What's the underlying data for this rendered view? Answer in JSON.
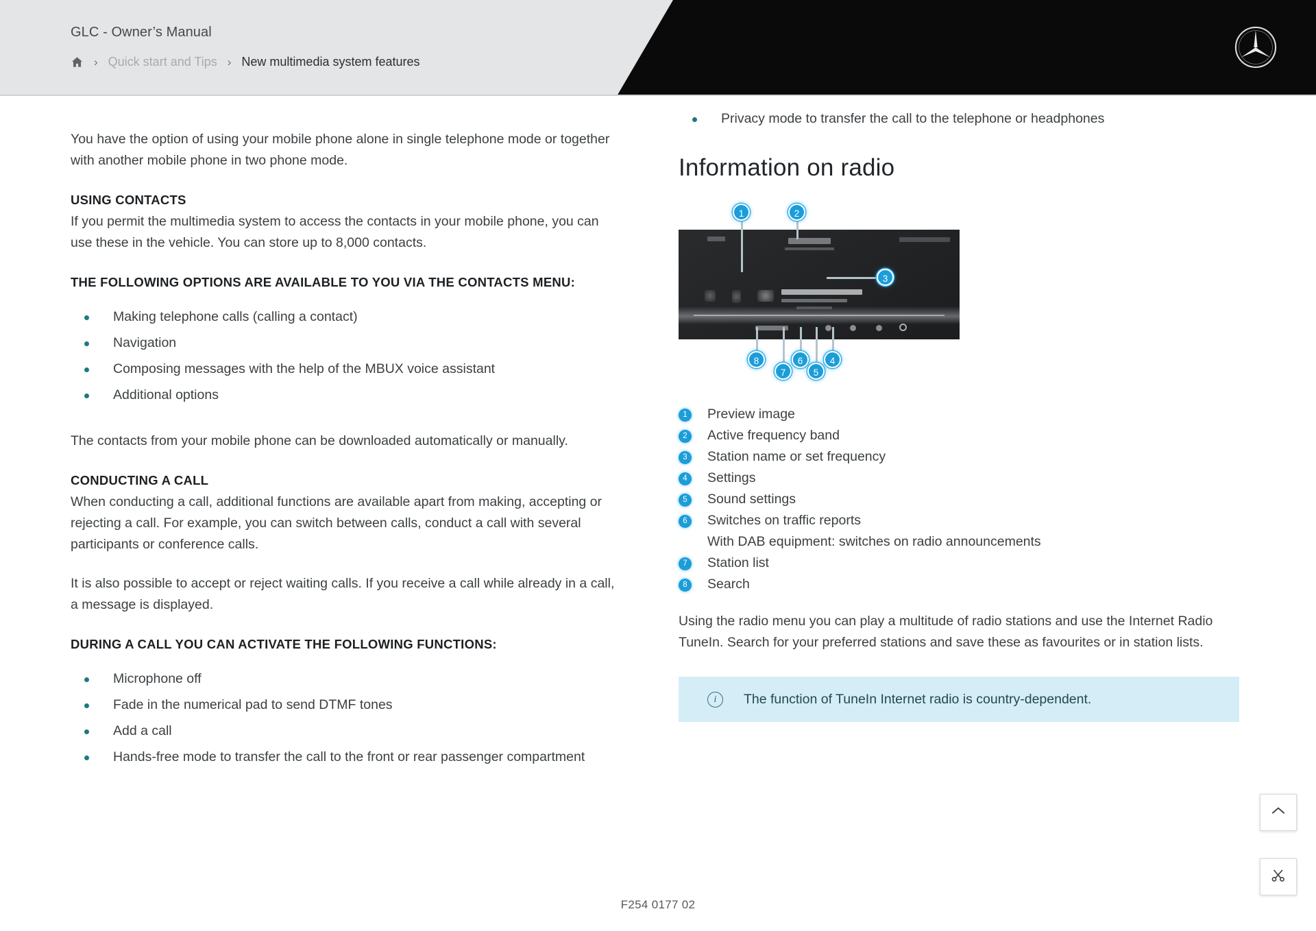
{
  "header": {
    "manual_title": "GLC - Owner’s Manual",
    "breadcrumb": {
      "home_icon": "home-icon",
      "separator": "›",
      "parent": "Quick start and Tips",
      "current": "New multimedia system features"
    },
    "brand_logo": "mercedes-star-icon"
  },
  "left_column": {
    "intro_paragraph": "You have the option of using your mobile phone alone in single telephone mode or together with another mobile phone in two phone mode.",
    "using_contacts": {
      "heading": "USING CONTACTS",
      "paragraph": "If you permit the multimedia system to access the contacts in your mobile phone, you can use these in the vehicle. You can store up to 8,000 contacts."
    },
    "contacts_menu": {
      "heading": "THE FOLLOWING OPTIONS ARE AVAILABLE TO YOU VIA THE CONTACTS MENU:",
      "items": [
        "Making telephone calls (calling a contact)",
        "Navigation",
        "Composing messages with the help of the MBUX voice assistant",
        "Additional options"
      ]
    },
    "download_paragraph": "The contacts from your mobile phone can be downloaded automatically or manually.",
    "conducting_a_call": {
      "heading": "CONDUCTING A CALL",
      "paragraph_1": "When conducting a call, additional functions are available apart from making, accepting or rejecting a call. For example, you can switch between calls, conduct a call with several participants or conference calls.",
      "paragraph_2": "It is also possible to accept or reject waiting calls. If you receive a call while already in a call, a message is displayed."
    },
    "during_a_call": {
      "heading": "DURING A CALL YOU CAN ACTIVATE THE FOLLOWING FUNCTIONS:",
      "items": [
        "Microphone off",
        "Fade in the numerical pad to send DTMF tones",
        "Add a call",
        "Hands-free mode to transfer the call to the front or rear passenger compartment"
      ]
    }
  },
  "right_column": {
    "privacy_bullet": "Privacy mode to transfer the call to the telephone or headphones",
    "section_heading": "Information on radio",
    "figure": {
      "alt": "radio-screen-illustration",
      "callouts": [
        "1",
        "2",
        "3",
        "4",
        "5",
        "6",
        "7",
        "8"
      ]
    },
    "legend": [
      {
        "num": "1",
        "text": "Preview image"
      },
      {
        "num": "2",
        "text": "Active frequency band"
      },
      {
        "num": "3",
        "text": "Station name or set frequency"
      },
      {
        "num": "4",
        "text": "Settings"
      },
      {
        "num": "5",
        "text": "Sound settings"
      },
      {
        "num": "6",
        "text": "Switches on traffic reports"
      },
      {
        "num": "7",
        "text": "Station list"
      },
      {
        "num": "8",
        "text": "Search"
      }
    ],
    "legend_subnote": "With DAB equipment: switches on radio announcements",
    "closing_paragraph": "Using the radio menu you can play a multitude of radio stations and use the Internet Radio TuneIn. Search for your preferred stations and save these as favourites or in station lists.",
    "info_notice": {
      "icon": "info-icon",
      "text": "The function of TuneIn Internet radio is country-dependent."
    }
  },
  "footer": {
    "document_code": "F254 0177 02"
  },
  "floating_buttons": {
    "scroll_top": "chevron-up-icon",
    "bookmark": "scissors-icon"
  },
  "colors": {
    "accent_cyan": "#1b9dd9",
    "bullet_teal": "#1a7a83",
    "info_box_bg": "#d5edf7",
    "header_bg": "#e4e5e6",
    "header_black": "#0a0a0a"
  }
}
